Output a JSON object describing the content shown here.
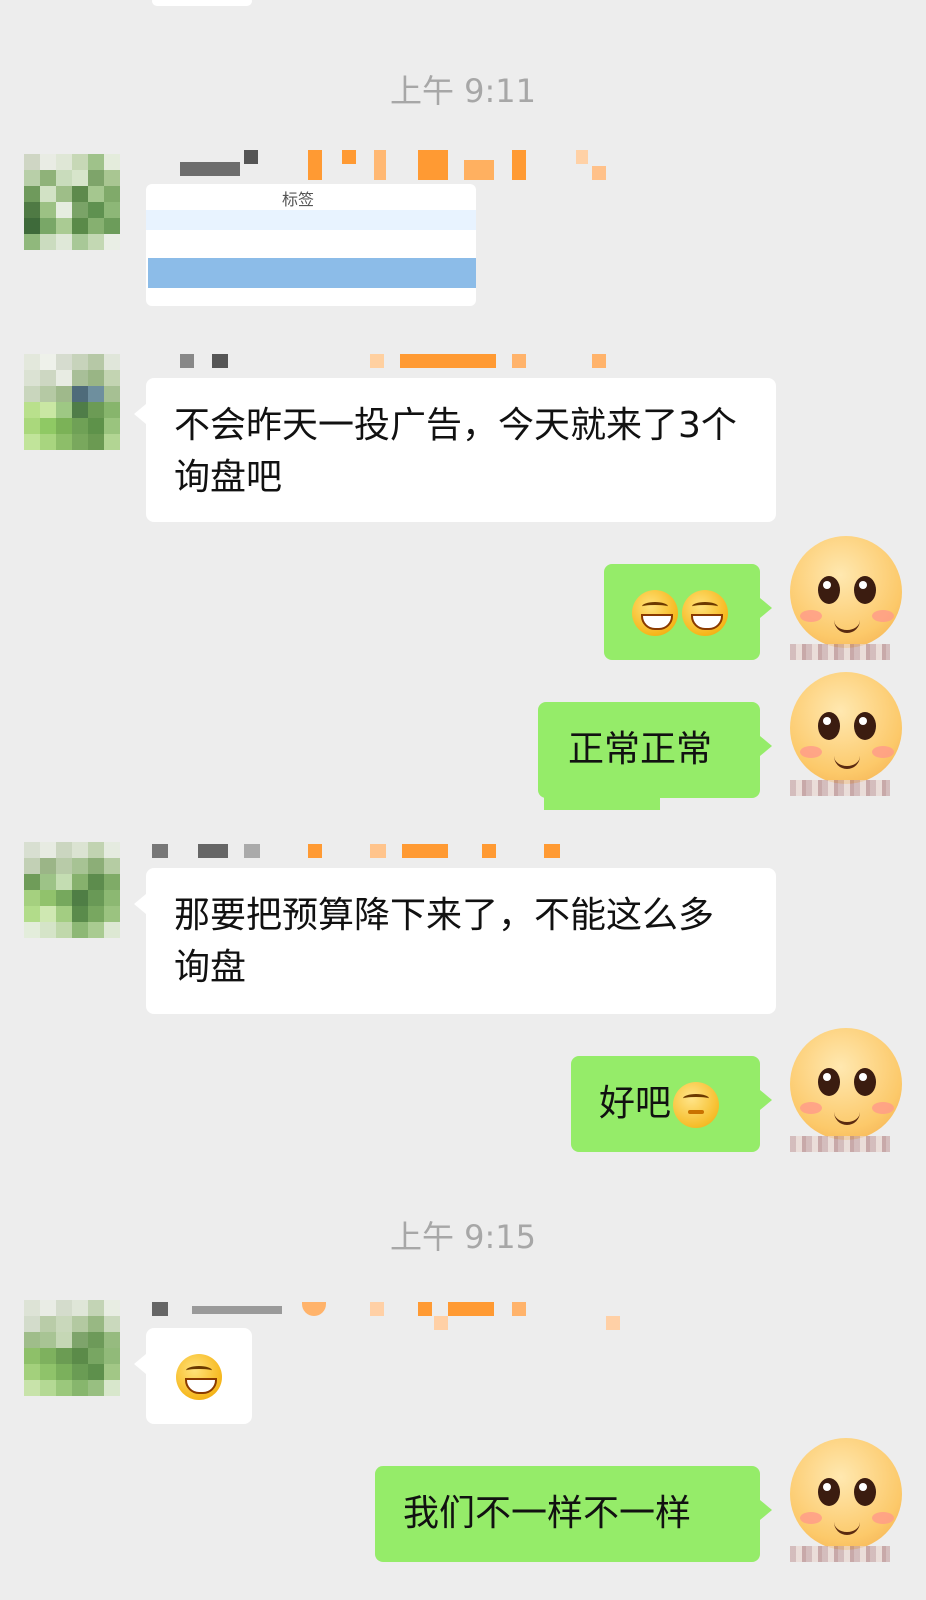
{
  "timestamps": [
    "上午 9:11",
    "上午 9:15"
  ],
  "image_message": {
    "tag_text": "标签"
  },
  "messages": [
    {
      "text": "不会昨天一投广告，今天就来了3个询盘吧"
    },
    {
      "text": ""
    },
    {
      "text": "正常正常"
    },
    {
      "text": "那要把预算降下来了，不能这么多询盘"
    },
    {
      "text": "好吧"
    },
    {
      "text": ""
    },
    {
      "text": "我们不一样不一样"
    }
  ],
  "colors": {
    "background": "#ededed",
    "incoming_bubble": "#ffffff",
    "outgoing_bubble": "#95ec69",
    "time_text": "#a7a7a7"
  }
}
